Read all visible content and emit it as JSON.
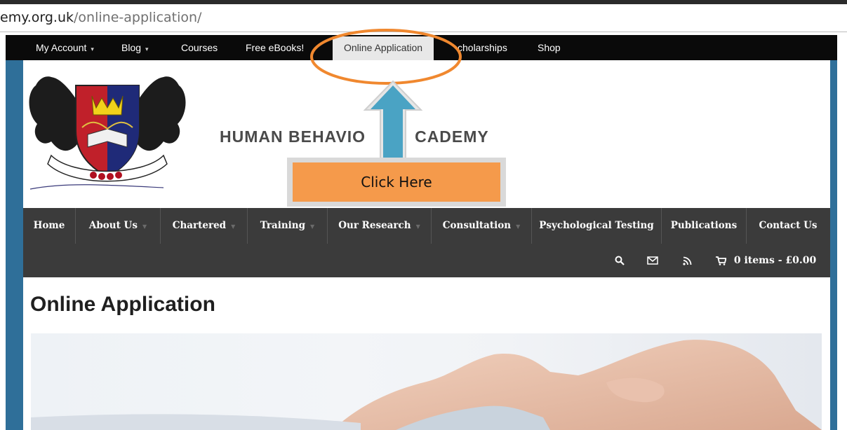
{
  "browser": {
    "url_host": "emy.org.uk",
    "url_path": "/online-application/"
  },
  "topbar": {
    "items": [
      {
        "label": "My Account",
        "dropdown": true
      },
      {
        "label": "Blog",
        "dropdown": true
      },
      {
        "label": "Courses",
        "dropdown": false
      },
      {
        "label": "Free eBooks!",
        "dropdown": false
      },
      {
        "label": "Online Application",
        "active": true
      },
      {
        "label": "cholarships",
        "dropdown": false
      },
      {
        "label": "Shop",
        "dropdown": false
      }
    ]
  },
  "site": {
    "title_left": "HUMAN BEHAVIO",
    "title_right": "CADEMY"
  },
  "mainnav": {
    "items": [
      {
        "label": "Home",
        "dropdown": false
      },
      {
        "label": "About Us",
        "dropdown": true
      },
      {
        "label": "Chartered",
        "dropdown": true
      },
      {
        "label": "Training",
        "dropdown": true
      },
      {
        "label": "Our Research",
        "dropdown": true
      },
      {
        "label": "Consultation",
        "dropdown": true
      },
      {
        "label": "Psychological Testing",
        "dropdown": false
      },
      {
        "label": "Publications",
        "dropdown": false
      },
      {
        "label": "Contact Us",
        "dropdown": false
      }
    ],
    "tools": {
      "search_icon": "search-icon",
      "mail_icon": "envelope-icon",
      "rss_icon": "rss-icon",
      "cart_icon": "cart-icon",
      "cart_text": "0 items - £0.00"
    }
  },
  "page": {
    "heading": "Online Application"
  },
  "annotation": {
    "callout": "Click Here",
    "ellipse_color": "#f0882f",
    "arrow_color": "#4aa3c4",
    "box_color": "#f59a4b"
  }
}
